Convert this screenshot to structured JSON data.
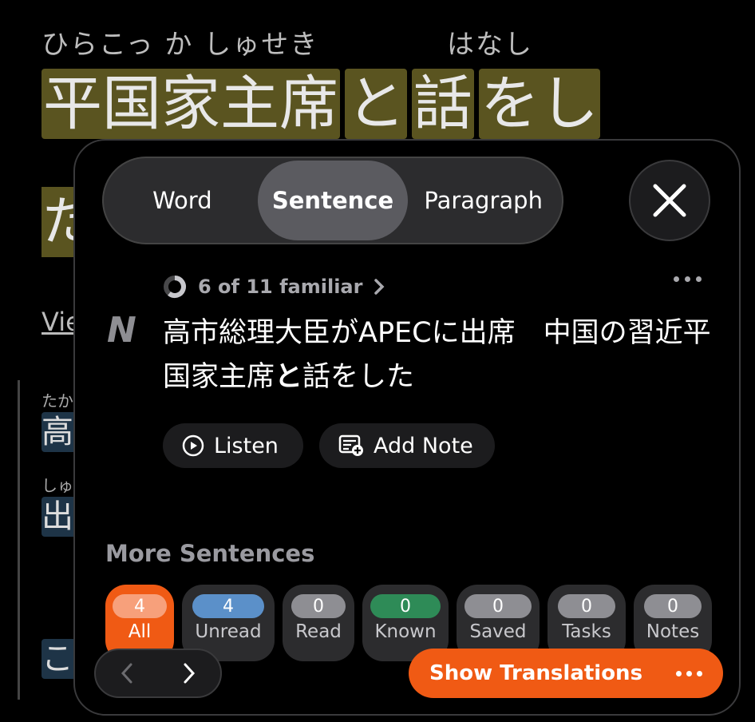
{
  "background": {
    "furigana": [
      "ひらこっ か しゅせき",
      "はなし"
    ],
    "title_segments": [
      "平国家主席",
      "と",
      "話",
      "をし"
    ],
    "title_line2": "た",
    "view_link": "View",
    "ruby_1": "たか",
    "word_1": "高",
    "ruby_2": "しゅ",
    "word_2": "出",
    "word_3": "こ"
  },
  "panel": {
    "tabs": [
      {
        "label": "Word",
        "active": false
      },
      {
        "label": "Sentence",
        "active": true
      },
      {
        "label": "Paragraph",
        "active": false
      }
    ],
    "close_icon": "close-icon",
    "familiar": "6 of 11 familiar",
    "source_logo": "N",
    "sentence_before": "高市総理大臣がAPECに出席　中国の習近平国家主席",
    "sentence_highlight": "と",
    "sentence_after": "話をした",
    "actions": {
      "listen": "Listen",
      "add_note": "Add Note"
    },
    "more_sentences_title": "More Sentences",
    "filters": [
      {
        "label": "All",
        "count": "4"
      },
      {
        "label": "Unread",
        "count": "4"
      },
      {
        "label": "Read",
        "count": "0"
      },
      {
        "label": "Known",
        "count": "0"
      },
      {
        "label": "Saved",
        "count": "0"
      },
      {
        "label": "Tasks",
        "count": "0"
      },
      {
        "label": "Notes",
        "count": "0"
      }
    ],
    "show_translations": "Show Translations"
  },
  "colors": {
    "accent": "#f05a14",
    "highlight_bg": "#5a5420",
    "unread": "#5b90c9",
    "known": "#2e8b57"
  }
}
